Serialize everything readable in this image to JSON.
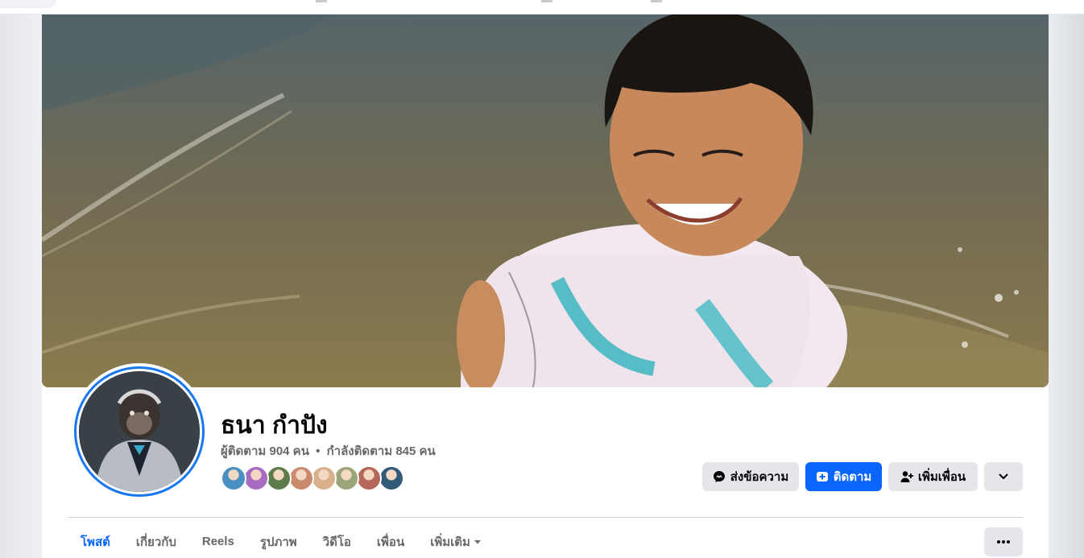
{
  "profile": {
    "name": "ธนา กำปัง",
    "followers_text": "ผู้ติดตาม 904 คน",
    "separator": "•",
    "following_text": "กำลังติดตาม 845 คน"
  },
  "friend_avatars": [
    {
      "color": "#4a90c2"
    },
    {
      "color": "#a86bc4"
    },
    {
      "color": "#5e7b4a"
    },
    {
      "color": "#c98a6e"
    },
    {
      "color": "#d8b08c"
    },
    {
      "color": "#9aa67a"
    },
    {
      "color": "#b5675a"
    },
    {
      "color": "#2f5a78"
    }
  ],
  "actions": {
    "message_label": "ส่งข้อความ",
    "follow_label": "ติดตาม",
    "add_friend_label": "เพิ่มเพื่อน"
  },
  "tabs": [
    {
      "label": "โพสต์",
      "active": true
    },
    {
      "label": "เกี่ยวกับ",
      "active": false
    },
    {
      "label": "Reels",
      "active": false
    },
    {
      "label": "รูปภาพ",
      "active": false
    },
    {
      "label": "วิดีโอ",
      "active": false
    },
    {
      "label": "เพื่อน",
      "active": false
    },
    {
      "label": "เพิ่มเติม",
      "active": false
    }
  ],
  "colors": {
    "accent": "#0866ff",
    "button_gray": "#e4e6eb",
    "text_secondary": "#65676b"
  }
}
